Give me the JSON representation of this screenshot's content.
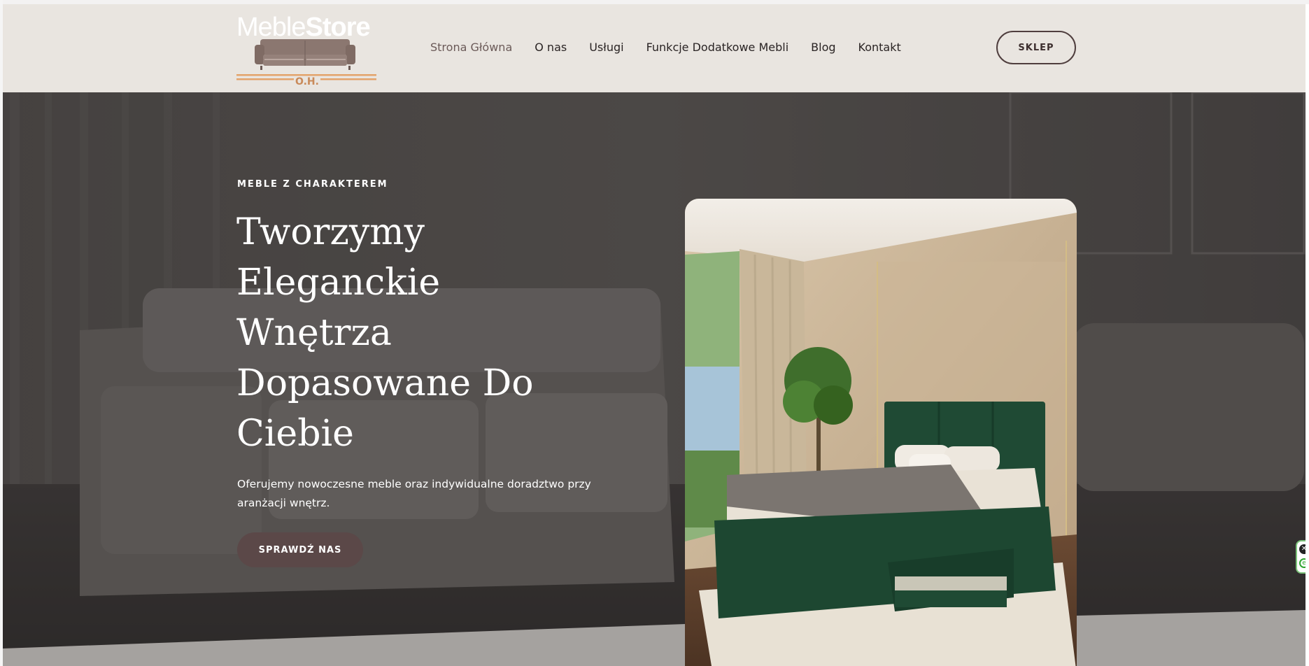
{
  "brand": {
    "logo_part1": "Meble",
    "logo_part2": "Store",
    "logo_sub": "O.H."
  },
  "nav": {
    "items": [
      {
        "label": "Strona Główna",
        "active": true
      },
      {
        "label": "O nas",
        "active": false
      },
      {
        "label": "Usługi",
        "active": false
      },
      {
        "label": "Funkcje Dodatkowe Mebli",
        "active": false
      },
      {
        "label": "Blog",
        "active": false
      },
      {
        "label": "Kontakt",
        "active": false
      }
    ],
    "shop_button": "SKLEP"
  },
  "hero": {
    "eyebrow": "MEBLE Z CHARAKTEREM",
    "headline_lines": [
      "Tworzymy",
      "Eleganckie",
      "Wnętrza",
      "Dopasowane Do",
      "Ciebie"
    ],
    "description": "Oferujemy nowoczesne meble oraz indywidualne doradztwo przy aranżacji wnętrz.",
    "cta": "SPRAWDŹ NAS"
  },
  "colors": {
    "header_bg": "#e9e5e0",
    "accent": "#5b4848",
    "nav_active": "#6b5a58",
    "bed_green": "#1f4a34"
  },
  "icons": {
    "sofa_logo": "sofa-icon",
    "widget_close": "close-icon",
    "widget_e": "e-icon"
  }
}
